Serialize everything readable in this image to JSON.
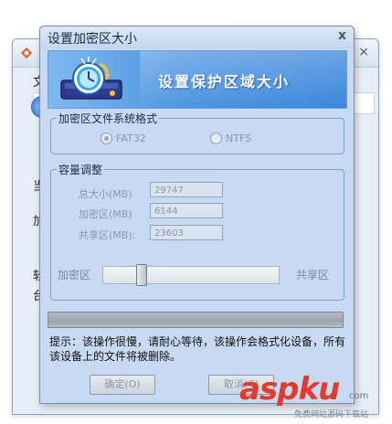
{
  "background_window": {
    "texts": [
      "文",
      "当",
      "加",
      "软",
      "台"
    ]
  },
  "dialog": {
    "title": "设置加密区大小",
    "close_symbol": "x",
    "banner_title": "设置保护区域大小",
    "fs_group": {
      "legend": "加密区文件系统格式",
      "options": [
        {
          "label": "FAT32",
          "selected": true
        },
        {
          "label": "NTFS",
          "selected": false
        }
      ]
    },
    "capacity_group": {
      "legend": "容量调整",
      "fields": [
        {
          "label": "总大小(MB)",
          "value": "29747"
        },
        {
          "label": "加密区(MB)",
          "value": "6144"
        },
        {
          "label": "共享区(MB):",
          "value": "23603"
        }
      ],
      "slider": {
        "left_label": "加密区",
        "right_label": "共享区",
        "value_fraction": 0.2
      }
    },
    "progress_fraction": 0,
    "hint": "提示：该操作很慢，请耐心等待，该操作会格式化设备，所有该设备上的文件将被删除。",
    "ok_label": "确定(O)",
    "cancel_label": "取消(C)"
  },
  "watermark": {
    "text": "aspku",
    "suffix": "com",
    "subtitle": "免费网站源码下载站"
  },
  "colors": {
    "dialog_bg": "#c7d9f3",
    "banner_blue": "#3b86dc",
    "watermark_red": "#e23a2c"
  }
}
